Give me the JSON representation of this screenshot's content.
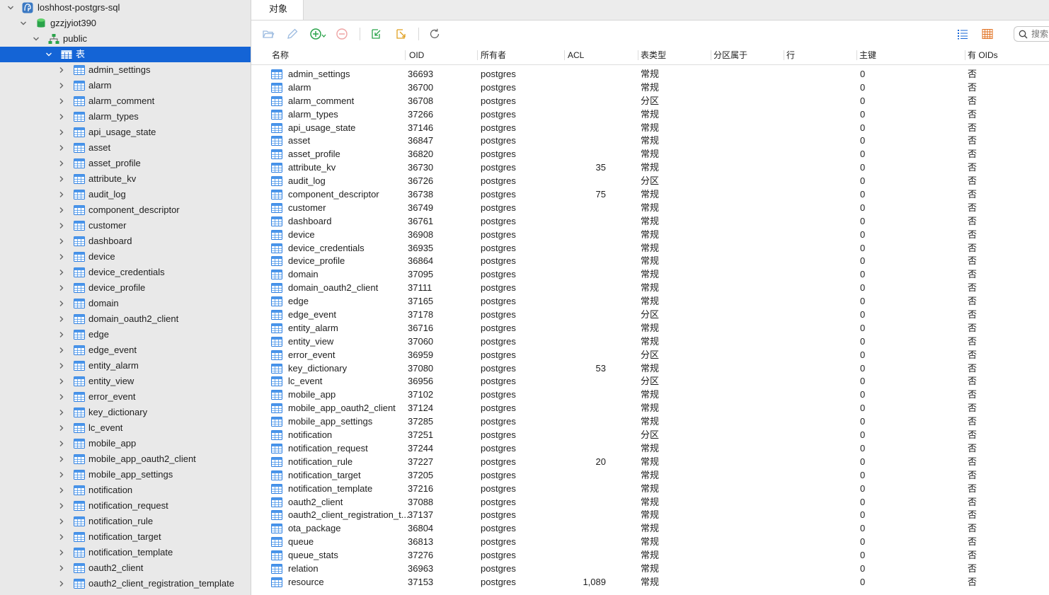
{
  "sidebar": {
    "server": "loshhost-postgrs-sql",
    "database": "gzzjyiot390",
    "schema": "public",
    "tables_node": "表",
    "tables": [
      "admin_settings",
      "alarm",
      "alarm_comment",
      "alarm_types",
      "api_usage_state",
      "asset",
      "asset_profile",
      "attribute_kv",
      "audit_log",
      "component_descriptor",
      "customer",
      "dashboard",
      "device",
      "device_credentials",
      "device_profile",
      "domain",
      "domain_oauth2_client",
      "edge",
      "edge_event",
      "entity_alarm",
      "entity_view",
      "error_event",
      "key_dictionary",
      "lc_event",
      "mobile_app",
      "mobile_app_oauth2_client",
      "mobile_app_settings",
      "notification",
      "notification_request",
      "notification_rule",
      "notification_target",
      "notification_template",
      "oauth2_client",
      "oauth2_client_registration_template"
    ]
  },
  "tab": {
    "label": "对象"
  },
  "search": {
    "placeholder": "搜索"
  },
  "columns": [
    "名称",
    "OID",
    "所有者",
    "ACL",
    "表类型",
    "分区属于",
    "行",
    "主键",
    "有 OIDs"
  ],
  "rows": [
    {
      "name": "admin_settings",
      "oid": "36693",
      "owner": "postgres",
      "type": "常规",
      "rows": "",
      "pk": "0",
      "oids": "否"
    },
    {
      "name": "alarm",
      "oid": "36700",
      "owner": "postgres",
      "type": "常规",
      "rows": "",
      "pk": "0",
      "oids": "否"
    },
    {
      "name": "alarm_comment",
      "oid": "36708",
      "owner": "postgres",
      "type": "分区",
      "rows": "",
      "pk": "0",
      "oids": "否"
    },
    {
      "name": "alarm_types",
      "oid": "37266",
      "owner": "postgres",
      "type": "常规",
      "rows": "",
      "pk": "0",
      "oids": "否"
    },
    {
      "name": "api_usage_state",
      "oid": "37146",
      "owner": "postgres",
      "type": "常规",
      "rows": "",
      "pk": "0",
      "oids": "否"
    },
    {
      "name": "asset",
      "oid": "36847",
      "owner": "postgres",
      "type": "常规",
      "rows": "",
      "pk": "0",
      "oids": "否"
    },
    {
      "name": "asset_profile",
      "oid": "36820",
      "owner": "postgres",
      "type": "常规",
      "rows": "",
      "pk": "0",
      "oids": "否"
    },
    {
      "name": "attribute_kv",
      "oid": "36730",
      "owner": "postgres",
      "type": "常规",
      "rows": "35",
      "pk": "0",
      "oids": "否"
    },
    {
      "name": "audit_log",
      "oid": "36726",
      "owner": "postgres",
      "type": "分区",
      "rows": "",
      "pk": "0",
      "oids": "否"
    },
    {
      "name": "component_descriptor",
      "oid": "36738",
      "owner": "postgres",
      "type": "常规",
      "rows": "75",
      "pk": "0",
      "oids": "否"
    },
    {
      "name": "customer",
      "oid": "36749",
      "owner": "postgres",
      "type": "常规",
      "rows": "",
      "pk": "0",
      "oids": "否"
    },
    {
      "name": "dashboard",
      "oid": "36761",
      "owner": "postgres",
      "type": "常规",
      "rows": "",
      "pk": "0",
      "oids": "否"
    },
    {
      "name": "device",
      "oid": "36908",
      "owner": "postgres",
      "type": "常规",
      "rows": "",
      "pk": "0",
      "oids": "否"
    },
    {
      "name": "device_credentials",
      "oid": "36935",
      "owner": "postgres",
      "type": "常规",
      "rows": "",
      "pk": "0",
      "oids": "否"
    },
    {
      "name": "device_profile",
      "oid": "36864",
      "owner": "postgres",
      "type": "常规",
      "rows": "",
      "pk": "0",
      "oids": "否"
    },
    {
      "name": "domain",
      "oid": "37095",
      "owner": "postgres",
      "type": "常规",
      "rows": "",
      "pk": "0",
      "oids": "否"
    },
    {
      "name": "domain_oauth2_client",
      "oid": "37111",
      "owner": "postgres",
      "type": "常规",
      "rows": "",
      "pk": "0",
      "oids": "否"
    },
    {
      "name": "edge",
      "oid": "37165",
      "owner": "postgres",
      "type": "常规",
      "rows": "",
      "pk": "0",
      "oids": "否"
    },
    {
      "name": "edge_event",
      "oid": "37178",
      "owner": "postgres",
      "type": "分区",
      "rows": "",
      "pk": "0",
      "oids": "否"
    },
    {
      "name": "entity_alarm",
      "oid": "36716",
      "owner": "postgres",
      "type": "常规",
      "rows": "",
      "pk": "0",
      "oids": "否"
    },
    {
      "name": "entity_view",
      "oid": "37060",
      "owner": "postgres",
      "type": "常规",
      "rows": "",
      "pk": "0",
      "oids": "否"
    },
    {
      "name": "error_event",
      "oid": "36959",
      "owner": "postgres",
      "type": "分区",
      "rows": "",
      "pk": "0",
      "oids": "否"
    },
    {
      "name": "key_dictionary",
      "oid": "37080",
      "owner": "postgres",
      "type": "常规",
      "rows": "53",
      "pk": "0",
      "oids": "否"
    },
    {
      "name": "lc_event",
      "oid": "36956",
      "owner": "postgres",
      "type": "分区",
      "rows": "",
      "pk": "0",
      "oids": "否"
    },
    {
      "name": "mobile_app",
      "oid": "37102",
      "owner": "postgres",
      "type": "常规",
      "rows": "",
      "pk": "0",
      "oids": "否"
    },
    {
      "name": "mobile_app_oauth2_client",
      "oid": "37124",
      "owner": "postgres",
      "type": "常规",
      "rows": "",
      "pk": "0",
      "oids": "否"
    },
    {
      "name": "mobile_app_settings",
      "oid": "37285",
      "owner": "postgres",
      "type": "常规",
      "rows": "",
      "pk": "0",
      "oids": "否"
    },
    {
      "name": "notification",
      "oid": "37251",
      "owner": "postgres",
      "type": "分区",
      "rows": "",
      "pk": "0",
      "oids": "否"
    },
    {
      "name": "notification_request",
      "oid": "37244",
      "owner": "postgres",
      "type": "常规",
      "rows": "",
      "pk": "0",
      "oids": "否"
    },
    {
      "name": "notification_rule",
      "oid": "37227",
      "owner": "postgres",
      "type": "常规",
      "rows": "20",
      "pk": "0",
      "oids": "否"
    },
    {
      "name": "notification_target",
      "oid": "37205",
      "owner": "postgres",
      "type": "常规",
      "rows": "",
      "pk": "0",
      "oids": "否"
    },
    {
      "name": "notification_template",
      "oid": "37216",
      "owner": "postgres",
      "type": "常规",
      "rows": "",
      "pk": "0",
      "oids": "否"
    },
    {
      "name": "oauth2_client",
      "oid": "37088",
      "owner": "postgres",
      "type": "常规",
      "rows": "",
      "pk": "0",
      "oids": "否"
    },
    {
      "name": "oauth2_client_registration_t...",
      "oid": "37137",
      "owner": "postgres",
      "type": "常规",
      "rows": "",
      "pk": "0",
      "oids": "否"
    },
    {
      "name": "ota_package",
      "oid": "36804",
      "owner": "postgres",
      "type": "常规",
      "rows": "",
      "pk": "0",
      "oids": "否"
    },
    {
      "name": "queue",
      "oid": "36813",
      "owner": "postgres",
      "type": "常规",
      "rows": "",
      "pk": "0",
      "oids": "否"
    },
    {
      "name": "queue_stats",
      "oid": "37276",
      "owner": "postgres",
      "type": "常规",
      "rows": "",
      "pk": "0",
      "oids": "否"
    },
    {
      "name": "relation",
      "oid": "36963",
      "owner": "postgres",
      "type": "常规",
      "rows": "",
      "pk": "0",
      "oids": "否"
    },
    {
      "name": "resource",
      "oid": "37153",
      "owner": "postgres",
      "type": "常规",
      "rows": "1,089",
      "pk": "0",
      "oids": "否"
    }
  ],
  "colors": {
    "selection": "#1464d6",
    "accent_green": "#2aa34a",
    "accent_red": "#e05a5a"
  }
}
